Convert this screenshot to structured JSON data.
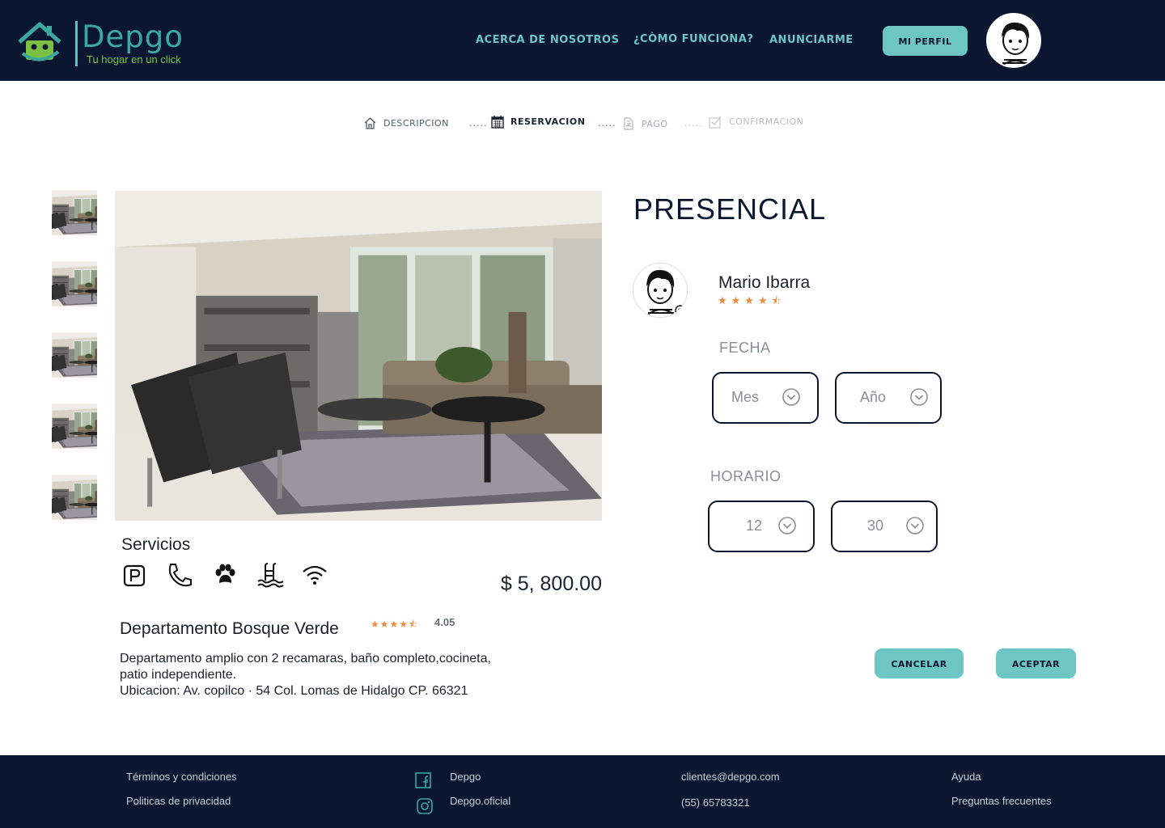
{
  "header": {
    "brand_name": "Depgo",
    "brand_tagline": "Tu hogar en un click",
    "nav": [
      "ACERCA DE NOSOTROS",
      "¿CÒMO FUNCIONA?",
      "ANUNCIARME"
    ],
    "profile_button": "MI PERFIL"
  },
  "stepper": {
    "steps": [
      "DESCRIPCION",
      "RESERVACION",
      "PAGO",
      "CONFIRMACION"
    ],
    "separator": ".....",
    "active_step": "RESERVACION"
  },
  "property": {
    "services_label": "Servicios",
    "services": [
      "parking-icon",
      "phone-icon",
      "pet-paw-icon",
      "pool-icon",
      "wifi-icon"
    ],
    "price": "$ 5, 800.00",
    "title": "Departamento Bosque Verde",
    "rating_stars": "★★★★⯪",
    "rating": "4.05",
    "description_line1": "Departamento amplio con 2 recamaras, baño completo,cocineta,",
    "description_line2": "patio independiente.",
    "description_line3": "Ubicacion: Av. copilco · 54 Col. Lomas de Hidalgo CP. 66321",
    "thumbnail_count": 5
  },
  "reservation": {
    "mode_title": "PRESENCIAL",
    "host_name": "Mario Ibarra",
    "host_stars": "★★★★⯪",
    "date_label": "FECHA",
    "month_placeholder": "Mes",
    "year_placeholder": "Año",
    "time_label": "HORARIO",
    "hour_value": "12",
    "minute_value": "30",
    "cancel_button": "CANCELAR",
    "accept_button": "ACEPTAR"
  },
  "footer": {
    "terms": "Términos y condiciones",
    "privacy": "Politicas  de privacidad",
    "facebook": "Depgo",
    "instagram": "Depgo.oficial",
    "email": "clientes@depgo.com",
    "phone": "(55) 65783321",
    "help": "Ayuda",
    "faq": "Preguntas frecuentes"
  },
  "colors": {
    "navy": "#0b1730",
    "teal": "#6ec6c4",
    "brand_teal": "#3aa99f",
    "brand_green": "#7ac143",
    "star_orange": "#ee8a3b"
  }
}
